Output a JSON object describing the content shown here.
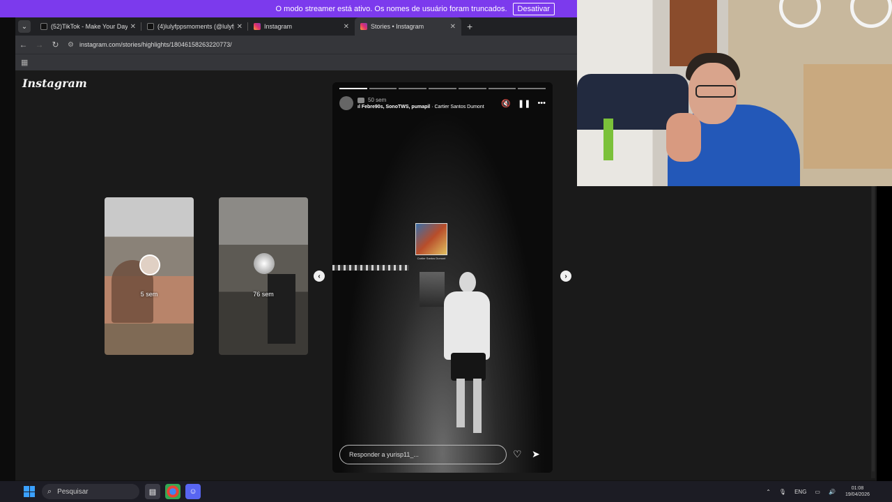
{
  "banner": {
    "message": "O modo streamer está ativo. Os nomes de usuário foram truncados.",
    "button": "Desativar"
  },
  "tabs": [
    {
      "title": "(52)TikTok - Make Your Day",
      "favicon_color": "#111111",
      "active": false
    },
    {
      "title": "(4)lulyfppsmoments (@lulyfpp...",
      "favicon_color": "#111111",
      "active": false
    },
    {
      "title": "Instagram",
      "favicon_color": "#e1306c",
      "active": false
    },
    {
      "title": "Stories • Instagram",
      "favicon_color": "#e1306c",
      "active": true
    }
  ],
  "address": {
    "url": "instagram.com/stories/highlights/18046158263220773/"
  },
  "page": {
    "logo": "Instagram",
    "thumbs": [
      {
        "label": "5 sem"
      },
      {
        "label": "76 sem"
      }
    ],
    "story": {
      "time": "50 sem",
      "artists": "Febre90s, SonoTWS, pumapil",
      "song": " · Cartier Santos Dumont",
      "music_caption": "Cartier Santos Dumont",
      "reply_placeholder": "Responder a yurisp11_...",
      "progress_segments": 7,
      "progress_done": 1
    }
  },
  "taskbar": {
    "search_placeholder": "Pesquisar",
    "language": "ENG",
    "time": "01:08",
    "date": "19/04/2026"
  },
  "colors": {
    "banner": "#7c3aed",
    "page_bg": "#1a1a1a",
    "tab_bar": "#202124"
  }
}
